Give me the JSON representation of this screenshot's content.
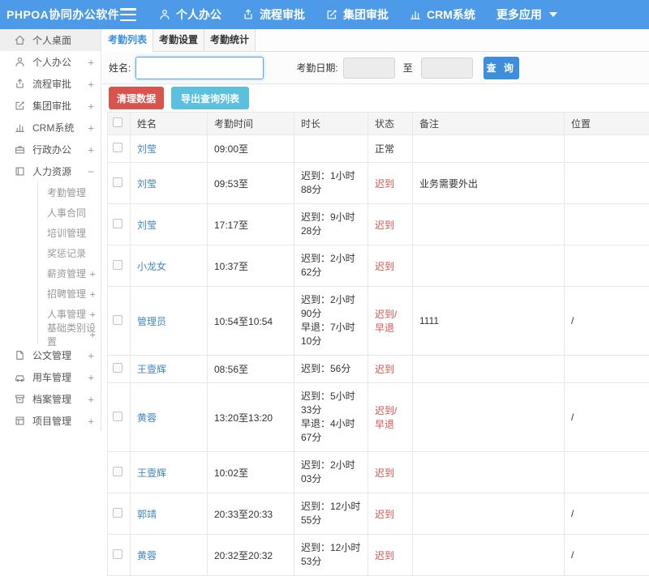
{
  "colors": {
    "header_bg": "#4d9be8",
    "accent_blue": "#3d8fdc",
    "link_blue": "#4287bd",
    "danger_red": "#d9534f",
    "info_cyan": "#5bc0de"
  },
  "header": {
    "logo": "PHPOA协同办公软件",
    "nav": [
      {
        "label": "个人办公",
        "icon": "user-icon"
      },
      {
        "label": "流程审批",
        "icon": "flow-icon"
      },
      {
        "label": "集团审批",
        "icon": "edit-icon"
      },
      {
        "label": "CRM系统",
        "icon": "chart-icon"
      },
      {
        "label": "更多应用",
        "icon": "caret-down-icon",
        "caret": true
      }
    ]
  },
  "sidebar": {
    "items": [
      {
        "label": "个人桌面",
        "icon": "home-icon",
        "active": true
      },
      {
        "label": "个人办公",
        "icon": "user-icon",
        "toggle": "+"
      },
      {
        "label": "流程审批",
        "icon": "flow-icon",
        "toggle": "+"
      },
      {
        "label": "集团审批",
        "icon": "edit-icon",
        "toggle": "+"
      },
      {
        "label": "CRM系统",
        "icon": "chart-icon",
        "toggle": "+"
      },
      {
        "label": "行政办公",
        "icon": "briefcase-icon",
        "toggle": "+"
      },
      {
        "label": "人力资源",
        "icon": "book-icon",
        "toggle": "−"
      },
      {
        "label": "考勤管理",
        "sub": true
      },
      {
        "label": "人事合同",
        "sub": true
      },
      {
        "label": "培训管理",
        "sub": true
      },
      {
        "label": "奖惩记录",
        "sub": true
      },
      {
        "label": "薪资管理",
        "sub": true,
        "toggle": "+"
      },
      {
        "label": "招聘管理",
        "sub": true,
        "toggle": "+"
      },
      {
        "label": "人事管理",
        "sub": true,
        "toggle": "+"
      },
      {
        "label": "基础类别设置",
        "sub": true,
        "toggle": "+"
      },
      {
        "label": "公文管理",
        "icon": "doc-icon",
        "toggle": "+"
      },
      {
        "label": "用车管理",
        "icon": "car-icon",
        "toggle": "+"
      },
      {
        "label": "档案管理",
        "icon": "archive-icon",
        "toggle": "+"
      },
      {
        "label": "项目管理",
        "icon": "project-icon",
        "toggle": "+"
      }
    ]
  },
  "tabs": [
    {
      "label": "考勤列表",
      "active": true
    },
    {
      "label": "考勤设置",
      "active": false
    },
    {
      "label": "考勤统计",
      "active": false
    }
  ],
  "search_form": {
    "name_label": "姓名:",
    "name_value": "",
    "date_label": "考勤日期:",
    "date_from": "",
    "to_label": "至",
    "date_to": "",
    "search_button": "查 询"
  },
  "actions": {
    "clean_button": "清理数据",
    "export_button": "导出查询列表"
  },
  "table": {
    "columns": [
      "姓名",
      "考勤时间",
      "时长",
      "状态",
      "备注",
      "位置"
    ],
    "rows": [
      {
        "name": "刘莹",
        "time": "09:00至",
        "duration": [],
        "status": "正常",
        "status_red": false,
        "note": "",
        "location": ""
      },
      {
        "name": "刘莹",
        "time": "09:53至",
        "duration": [
          "迟到：1小时88分"
        ],
        "status": "迟到",
        "status_red": true,
        "note": "业务需要外出",
        "location": ""
      },
      {
        "name": "刘莹",
        "time": "17:17至",
        "duration": [
          "迟到：9小时28分"
        ],
        "status": "迟到",
        "status_red": true,
        "note": "",
        "location": ""
      },
      {
        "name": "小龙女",
        "time": "10:37至",
        "duration": [
          "迟到：2小时62分"
        ],
        "status": "迟到",
        "status_red": true,
        "note": "",
        "location": ""
      },
      {
        "name": "管理员",
        "time": "10:54至10:54",
        "duration": [
          "迟到：2小时90分",
          "早退：7小时10分"
        ],
        "status": "迟到/早退",
        "status_red": true,
        "note": "1111",
        "location": "/"
      },
      {
        "name": "王壹辉",
        "time": "08:56至",
        "duration": [
          "迟到：56分"
        ],
        "status": "迟到",
        "status_red": true,
        "note": "",
        "location": ""
      },
      {
        "name": "黄蓉",
        "time": "13:20至13:20",
        "duration": [
          "迟到：5小时33分",
          "早退：4小时67分"
        ],
        "status": "迟到/早退",
        "status_red": true,
        "note": "",
        "location": "/"
      },
      {
        "name": "王壹辉",
        "time": "10:02至",
        "duration": [
          "迟到：2小时03分"
        ],
        "status": "迟到",
        "status_red": true,
        "note": "",
        "location": ""
      },
      {
        "name": "郭靖",
        "time": "20:33至20:33",
        "duration": [
          "迟到：12小时55分"
        ],
        "status": "迟到",
        "status_red": true,
        "note": "",
        "location": "/"
      },
      {
        "name": "黄蓉",
        "time": "20:32至20:32",
        "duration": [
          "迟到：12小时53分"
        ],
        "status": "迟到",
        "status_red": true,
        "note": "",
        "location": "/"
      }
    ]
  }
}
